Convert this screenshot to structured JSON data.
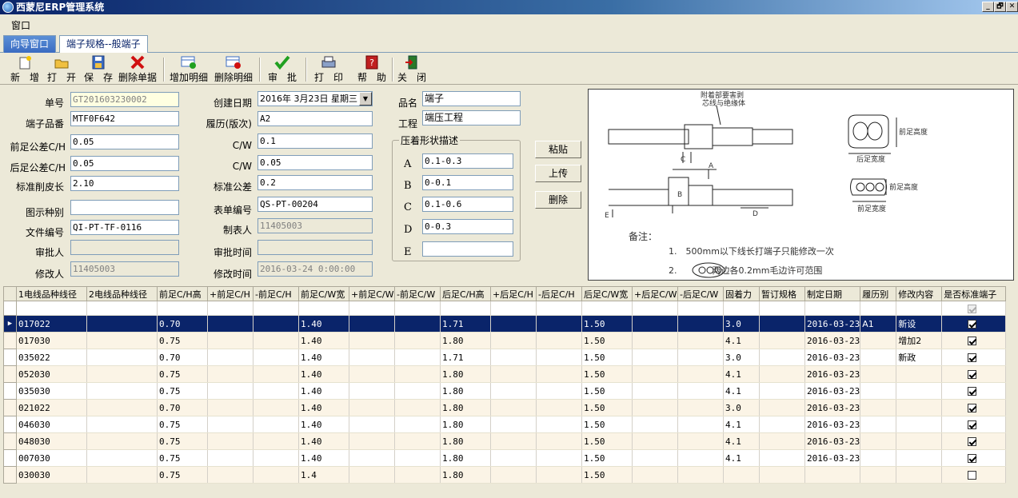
{
  "window": {
    "title": "西蒙尼ERP管理系统",
    "min": "_",
    "restore": "🗗",
    "close": "✕"
  },
  "menu": {
    "window": "窗口"
  },
  "tabs": [
    {
      "label": "向导窗口"
    },
    {
      "label": "端子规格--般端子"
    }
  ],
  "toolbar": {
    "new": "新　增",
    "open": "打　开",
    "save": "保　存",
    "delete_doc": "删除单据",
    "add_detail": "增加明细",
    "del_detail": "删除明细",
    "approve": "审　批",
    "print": "打　印",
    "help": "帮　助",
    "close": "关　闭"
  },
  "form": {
    "doc_no_label": "单号",
    "doc_no": "GT201603230002",
    "terminal_model_label": "端子品番",
    "terminal_model": "MTF0F642",
    "front_tol_label": "前足公差C/H",
    "front_tol": "0.05",
    "rear_tol_label": "后足公差C/H",
    "rear_tol": "0.05",
    "strip_len_label": "标准削皮长",
    "strip_len": "2.10",
    "drawing_type_label": "图示种别",
    "drawing_type": "",
    "file_no_label": "文件编号",
    "file_no": "QI-PT-TF-0116",
    "approver_label": "审批人",
    "approver": "",
    "modifier_label": "修改人",
    "modifier": "11405003",
    "create_date_label": "创建日期",
    "create_date": "2016年 3月23日 星期三",
    "revision_label": "履历(版次)",
    "revision": "A2",
    "cw1_label": "C/W",
    "cw1": "0.1",
    "cw2_label": "C/W",
    "cw2": "0.05",
    "std_tol_label": "标准公差",
    "std_tol": "0.2",
    "form_no_label": "表单编号",
    "form_no": "QS-PT-00204",
    "maker_label": "制表人",
    "maker": "11405003",
    "approve_time_label": "审批时间",
    "approve_time": "",
    "modify_time_label": "修改时间",
    "modify_time": "2016-03-24 0:00:00",
    "product_label": "品名",
    "product": "端子",
    "process_label": "工程",
    "process": "端压工程",
    "shape_group": "压着形状描述",
    "shape_a_label": "A",
    "shape_a": "0.1-0.3",
    "shape_b_label": "B",
    "shape_b": "0-0.1",
    "shape_c_label": "C",
    "shape_c": "0.1-0.6",
    "shape_d_label": "D",
    "shape_d": "0-0.3",
    "shape_e_label": "E",
    "shape_e": "",
    "paste": "粘贴",
    "upload": "上传",
    "remove": "删除"
  },
  "drawing": {
    "top_note": "附着部要害剥",
    "top_note2": "芯线与绝缘体",
    "right_h": "前足高度",
    "right_w": "后足宽度",
    "right_h2": "前足高度",
    "right_w2": "前足宽度",
    "lbl_c": "C",
    "lbl_a": "A",
    "lbl_b": "B",
    "lbl_d": "D",
    "lbl_e": "E",
    "note_title": "备注：",
    "note1": "1.　500mm以下线长打端子只能修改一次",
    "note2": "2.　　　　两边各0.2mm毛边许可范围"
  },
  "grid": {
    "columns": [
      "1电线品种线径",
      "2电线品种线径",
      "前足C/H高",
      "+前足C/H",
      "-前足C/H",
      "前足C/W宽",
      "+前足C/W",
      "-前足C/W",
      "后足C/H高",
      "+后足C/H",
      "-后足C/H",
      "后足C/W宽",
      "+后足C/W",
      "-后足C/W",
      "固着力",
      "暂订规格",
      "制定日期",
      "履历别",
      "修改内容",
      "是否标准端子"
    ],
    "rows": [
      [
        "017022",
        "",
        "0.70",
        "",
        "",
        "1.40",
        "",
        "",
        "1.71",
        "",
        "",
        "1.50",
        "",
        "",
        "3.0",
        "",
        "2016-03-23",
        "A1",
        "新设",
        true
      ],
      [
        "017030",
        "",
        "0.75",
        "",
        "",
        "1.40",
        "",
        "",
        "1.80",
        "",
        "",
        "1.50",
        "",
        "",
        "4.1",
        "",
        "2016-03-23",
        "",
        "增加2",
        true
      ],
      [
        "035022",
        "",
        "0.70",
        "",
        "",
        "1.40",
        "",
        "",
        "1.71",
        "",
        "",
        "1.50",
        "",
        "",
        "3.0",
        "",
        "2016-03-23",
        "",
        "新政",
        true
      ],
      [
        "052030",
        "",
        "0.75",
        "",
        "",
        "1.40",
        "",
        "",
        "1.80",
        "",
        "",
        "1.50",
        "",
        "",
        "4.1",
        "",
        "2016-03-23",
        "",
        "",
        true
      ],
      [
        "035030",
        "",
        "0.75",
        "",
        "",
        "1.40",
        "",
        "",
        "1.80",
        "",
        "",
        "1.50",
        "",
        "",
        "4.1",
        "",
        "2016-03-23",
        "",
        "",
        true
      ],
      [
        "021022",
        "",
        "0.70",
        "",
        "",
        "1.40",
        "",
        "",
        "1.80",
        "",
        "",
        "1.50",
        "",
        "",
        "3.0",
        "",
        "2016-03-23",
        "",
        "",
        true
      ],
      [
        "046030",
        "",
        "0.75",
        "",
        "",
        "1.40",
        "",
        "",
        "1.80",
        "",
        "",
        "1.50",
        "",
        "",
        "4.1",
        "",
        "2016-03-23",
        "",
        "",
        true
      ],
      [
        "048030",
        "",
        "0.75",
        "",
        "",
        "1.40",
        "",
        "",
        "1.80",
        "",
        "",
        "1.50",
        "",
        "",
        "4.1",
        "",
        "2016-03-23",
        "",
        "",
        true
      ],
      [
        "007030",
        "",
        "0.75",
        "",
        "",
        "1.40",
        "",
        "",
        "1.80",
        "",
        "",
        "1.50",
        "",
        "",
        "4.1",
        "",
        "2016-03-23",
        "",
        "",
        true
      ],
      [
        "030030",
        "",
        "0.75",
        "",
        "",
        "1.4",
        "",
        "",
        "1.80",
        "",
        "",
        "1.50",
        "",
        "",
        "",
        "",
        "",
        "",
        "",
        false
      ]
    ],
    "current_row_marker": "▶"
  }
}
